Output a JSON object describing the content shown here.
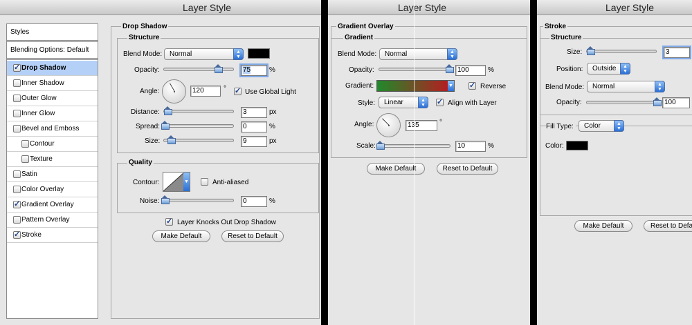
{
  "window_title": "Layer Style",
  "styles_panel": {
    "header": "Styles",
    "blending_options": "Blending Options: Default",
    "items": [
      {
        "label": "Drop Shadow",
        "checked": true,
        "selected": true,
        "indent": false
      },
      {
        "label": "Inner Shadow",
        "checked": false,
        "selected": false,
        "indent": false
      },
      {
        "label": "Outer Glow",
        "checked": false,
        "selected": false,
        "indent": false
      },
      {
        "label": "Inner Glow",
        "checked": false,
        "selected": false,
        "indent": false
      },
      {
        "label": "Bevel and Emboss",
        "checked": false,
        "selected": false,
        "indent": false
      },
      {
        "label": "Contour",
        "checked": false,
        "selected": false,
        "indent": true
      },
      {
        "label": "Texture",
        "checked": false,
        "selected": false,
        "indent": true
      },
      {
        "label": "Satin",
        "checked": false,
        "selected": false,
        "indent": false
      },
      {
        "label": "Color Overlay",
        "checked": false,
        "selected": false,
        "indent": false
      },
      {
        "label": "Gradient Overlay",
        "checked": true,
        "selected": false,
        "indent": false
      },
      {
        "label": "Pattern Overlay",
        "checked": false,
        "selected": false,
        "indent": false
      },
      {
        "label": "Stroke",
        "checked": true,
        "selected": false,
        "indent": false
      }
    ]
  },
  "drop_shadow": {
    "title": "Drop Shadow",
    "structure": "Structure",
    "blend_mode_label": "Blend Mode:",
    "blend_mode": "Normal",
    "opacity_label": "Opacity:",
    "opacity": "75",
    "opacity_unit": "%",
    "opacity_fraction": 0.75,
    "angle_label": "Angle:",
    "angle": "120",
    "degree": "°",
    "use_global_light": "Use Global Light",
    "distance_label": "Distance:",
    "distance": "3",
    "distance_unit": "px",
    "spread_label": "Spread:",
    "spread": "0",
    "spread_unit": "%",
    "size_label": "Size:",
    "size": "9",
    "size_unit": "px",
    "quality": "Quality",
    "contour_label": "Contour:",
    "anti_aliased": "Anti-aliased",
    "noise_label": "Noise:",
    "noise": "0",
    "noise_unit": "%",
    "knocks_out": "Layer Knocks Out Drop Shadow",
    "make_default": "Make Default",
    "reset_default": "Reset to Default",
    "shadow_color": "#000000"
  },
  "gradient_overlay": {
    "title": "Gradient Overlay",
    "section": "Gradient",
    "blend_mode_label": "Blend Mode:",
    "blend_mode": "Normal",
    "opacity_label": "Opacity:",
    "opacity": "100",
    "opacity_unit": "%",
    "gradient_label": "Gradient:",
    "reverse": "Reverse",
    "style_label": "Style:",
    "style": "Linear",
    "align_with_layer": "Align with Layer",
    "angle_label": "Angle:",
    "angle": "135",
    "degree": "°",
    "scale_label": "Scale:",
    "scale": "10",
    "scale_unit": "%",
    "make_default": "Make Default",
    "reset_default": "Reset to Default",
    "gradient_colors": [
      "#1f8a2a",
      "#c21420"
    ]
  },
  "stroke": {
    "title": "Stroke",
    "structure": "Structure",
    "size_label": "Size:",
    "size": "3",
    "position_label": "Position:",
    "position": "Outside",
    "blend_mode_label": "Blend Mode:",
    "blend_mode": "Normal",
    "opacity_label": "Opacity:",
    "opacity": "100",
    "fill_type_label": "Fill Type:",
    "fill_type": "Color",
    "color_label": "Color:",
    "make_default": "Make Default",
    "reset_default": "Reset to Defau",
    "stroke_color": "#000000"
  }
}
